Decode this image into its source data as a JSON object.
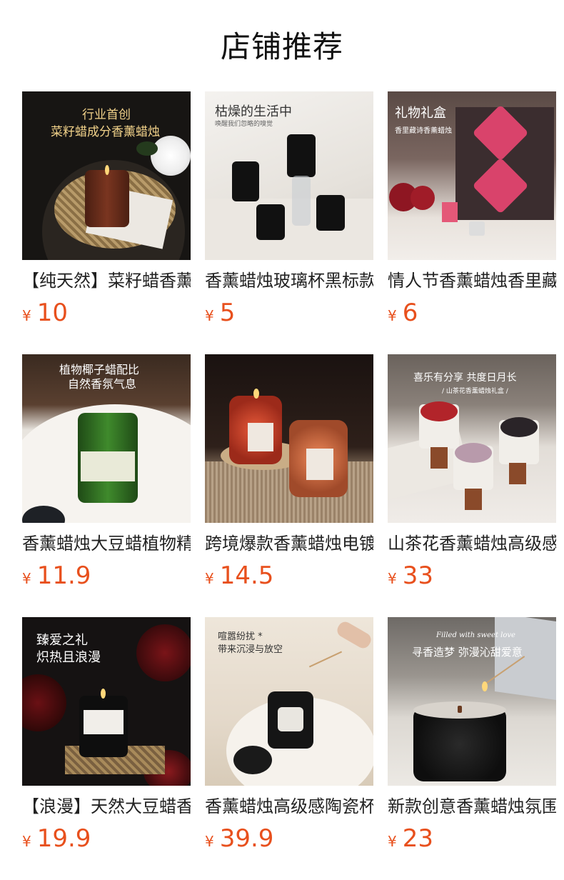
{
  "page_title": "店铺推荐",
  "currency": "¥",
  "accent_color": "#e8501d",
  "products": [
    {
      "name": "【纯天然】菜籽蜡香薰蜡烛",
      "price": "10",
      "overlay": [
        "行业首创",
        "菜籽蜡成分香薰蜡烛"
      ]
    },
    {
      "name": "香薰蜡烛玻璃杯黑标款",
      "price": "5",
      "overlay": [
        "枯燥的生活中",
        "唤醒我们忽略的嗅觉"
      ]
    },
    {
      "name": "情人节香薰蜡烛香里藏诗礼盒",
      "price": "6",
      "overlay": [
        "礼物礼盒",
        "香里藏诗香薰蜡烛"
      ]
    },
    {
      "name": "香薰蜡烛大豆蜡植物精油",
      "price": "11.9",
      "overlay": [
        "植物椰子蜡配比",
        "自然香氛气息"
      ]
    },
    {
      "name": "跨境爆款香薰蜡烛电镀玻璃",
      "price": "14.5",
      "overlay": []
    },
    {
      "name": "山茶花香薰蜡烛高级感礼盒",
      "price": "33",
      "overlay": [
        "喜乐有分享 共度日月长",
        "/ 山茶花香薰蜡烛礼盒 /"
      ]
    },
    {
      "name": "【浪漫】天然大豆蜡香薰蜡烛",
      "price": "19.9",
      "overlay": [
        "臻爱之礼",
        "炽热且浪漫"
      ]
    },
    {
      "name": "香薰蜡烛高级感陶瓷杯",
      "price": "39.9",
      "overlay": [
        "喧嚣纷扰 *",
        "带来沉浸与放空"
      ]
    },
    {
      "name": "新款创意香薰蜡烛氛围感",
      "price": "23",
      "overlay": [
        "Filled with sweet love",
        "寻香造梦 弥漫沁甜爱意"
      ]
    }
  ]
}
